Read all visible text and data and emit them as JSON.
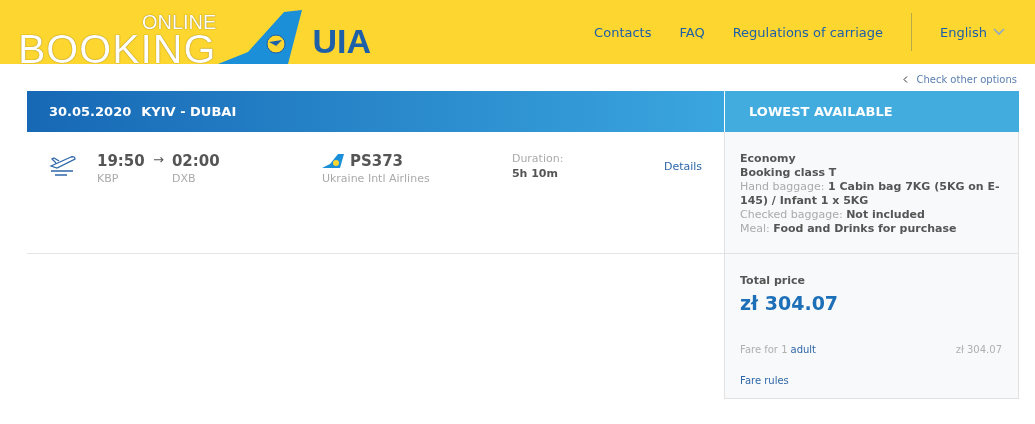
{
  "header": {
    "logo_small": "ONLINE",
    "logo_big": "BOOKING",
    "brand": "UIA",
    "nav": [
      "Contacts",
      "FAQ",
      "Regulations of carriage"
    ],
    "language": "English"
  },
  "back_link": "Check other options",
  "route_bar": {
    "date": "30.05.2020",
    "route": "KYIV - DUBAI"
  },
  "fare_header": "LOWEST AVAILABLE",
  "flight": {
    "departure_time": "19:50",
    "arrow": "→",
    "arrival_time": "02:00",
    "departure_airport": "KBP",
    "arrival_airport": "DXB",
    "flight_number": "PS373",
    "airline": "Ukraine Intl Airlines",
    "duration_label": "Duration:",
    "duration": "5h 10m",
    "details": "Details"
  },
  "fare": {
    "cabin": "Economy",
    "booking_class": "Booking class T",
    "lines": [
      "Hand baggage: **1 Cabin bag 7KG (5KG on E-145) / Infant 1 x 5KG**",
      "Checked baggage: **Not included**",
      "Meal: **Food and Drinks for purchase**"
    ]
  },
  "total": {
    "label": "Total price",
    "amount": "zł 304.07",
    "fare_for": "Fare for 1",
    "fare_for_link": "adult",
    "fare_amount": "zł 304.07",
    "rules": "Fare rules"
  }
}
